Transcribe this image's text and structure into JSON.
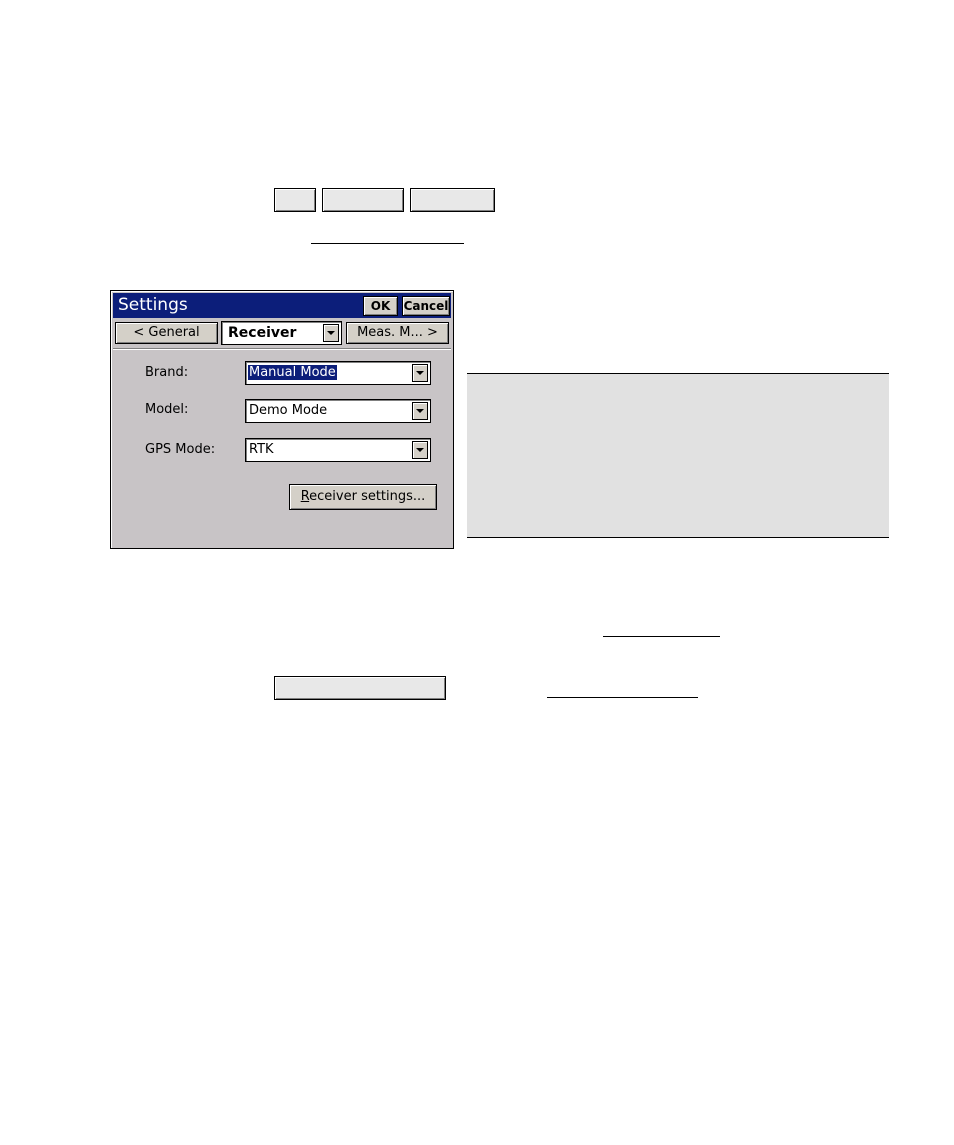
{
  "dialog": {
    "title": "Settings",
    "ok_label": "OK",
    "cancel_label": "Cancel",
    "prev_tab_label": "< General",
    "current_tab_label": "Receiver",
    "next_tab_label": "Meas. M... >",
    "fields": {
      "brand": {
        "label": "Brand:",
        "value": "Manual Mode"
      },
      "model": {
        "label": "Model:",
        "value": "Demo Mode"
      },
      "gps_mode": {
        "label": "GPS Mode:",
        "value": "RTK"
      }
    },
    "receiver_settings": {
      "mnemonic": "R",
      "rest": "eceiver settings..."
    }
  },
  "colors": {
    "titlebar": "#0c1e7a",
    "dialog_face": "#c8c4c6",
    "note_background": "#e1e1e1"
  }
}
